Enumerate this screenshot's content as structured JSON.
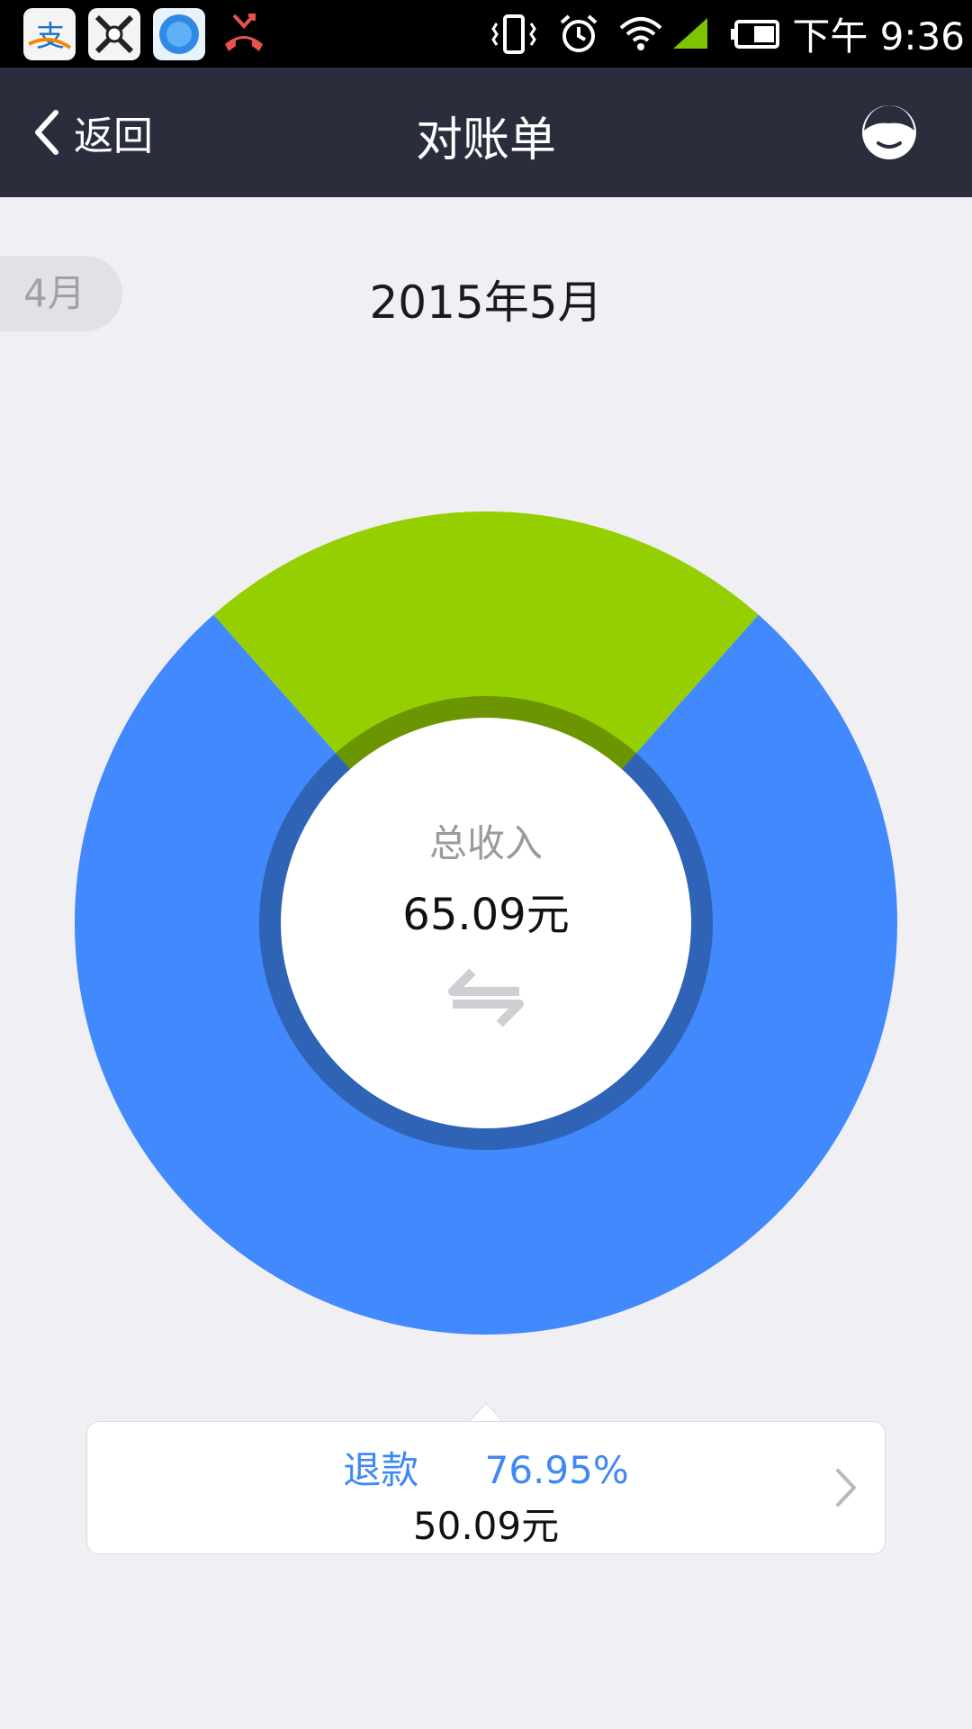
{
  "nav": {
    "back_label": "返回",
    "title": "对账单"
  },
  "month": {
    "prev_label": "4月",
    "current_label": "2015年5月"
  },
  "status_bar": {
    "time": "下午 9:36"
  },
  "summary": {
    "label": "总收入",
    "value": "65.09元"
  },
  "detail": {
    "category": "退款",
    "percent": "76.95%",
    "amount": "50.09元"
  },
  "chart_data": {
    "type": "pie",
    "total_label": "总收入",
    "total_value": 65.09,
    "slices": [
      {
        "label": "退款",
        "value": 50.09,
        "percent": 76.95,
        "color": "#4189fc"
      },
      {
        "value": 15.0,
        "percent": 23.05,
        "color": "#95cf02"
      }
    ]
  },
  "colors": {
    "nav_bg": "#2a2d3c",
    "accent": "#3f88f5",
    "refund_slice": "#4189fc",
    "other_slice": "#95cf02"
  },
  "icons": {
    "back": "chevron-left-icon",
    "user": "user-face-icon",
    "switch": "swap-arrows-icon",
    "card_arrow": "chevron-right-icon"
  }
}
